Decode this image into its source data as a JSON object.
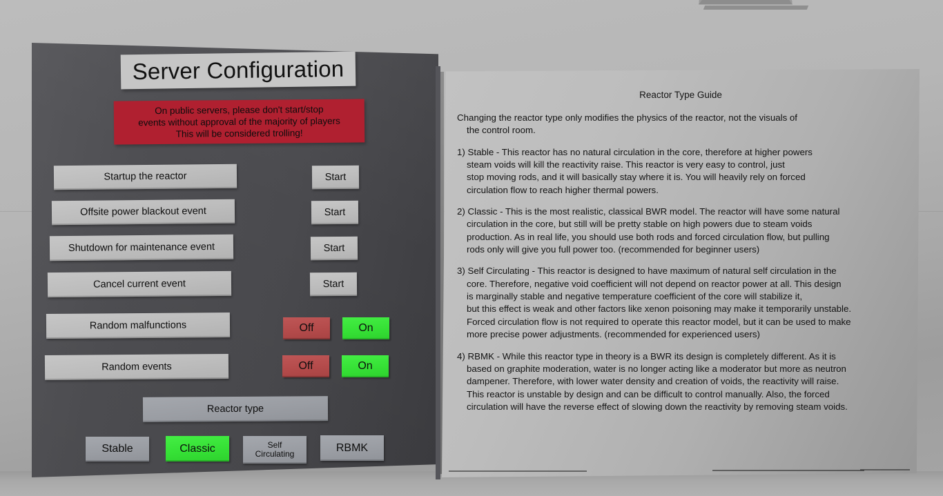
{
  "left_panel": {
    "title": "Server Configuration",
    "warning_lines": [
      "On public servers, please don't start/stop",
      "events without approval of the majority of players",
      "This will be considered trolling!"
    ],
    "actions": [
      {
        "label": "Startup the reactor",
        "button": "Start"
      },
      {
        "label": "Offsite power blackout event",
        "button": "Start"
      },
      {
        "label": "Shutdown for maintenance event",
        "button": "Start"
      },
      {
        "label": "Cancel current event",
        "button": "Start"
      }
    ],
    "toggles": [
      {
        "label": "Random malfunctions",
        "off": "Off",
        "on": "On",
        "selected": "On"
      },
      {
        "label": "Random events",
        "off": "Off",
        "on": "On",
        "selected": "On"
      }
    ],
    "reactor_type_label": "Reactor type",
    "reactor_types": [
      {
        "label": "Stable",
        "line1": "Stable",
        "line2": "",
        "selected": false
      },
      {
        "label": "Classic",
        "line1": "Classic",
        "line2": "",
        "selected": true
      },
      {
        "label": "Self Circulating",
        "line1": "Self",
        "line2": "Circulating",
        "selected": false
      },
      {
        "label": "RBMK",
        "line1": "RBMK",
        "line2": "",
        "selected": false
      }
    ]
  },
  "right_panel": {
    "title": "Reactor Type Guide",
    "paragraphs": [
      {
        "lines": [
          "Changing the reactor type only modifies the physics of the reactor, not the visuals of",
          "the control room."
        ],
        "indent_from": 1
      },
      {
        "lines": [
          "1) Stable - This reactor has no natural circulation in the core, therefore at higher powers",
          "steam voids will kill the reactivity raise.  This reactor is very easy to control, just",
          "stop moving rods, and it will basically stay where it is. You will heavily rely on forced",
          "circulation flow to reach higher thermal powers."
        ],
        "indent_from": 1
      },
      {
        "lines": [
          "2) Classic - This is the most realistic, classical BWR model. The reactor will have some natural",
          "circulation in the core, but still will be pretty stable on high powers due to steam voids",
          "production. As in real life, you should use both rods and forced circulation flow, but pulling",
          "rods only will give you full power too. (recommended for beginner users)"
        ],
        "indent_from": 1
      },
      {
        "lines": [
          "3) Self Circulating - This reactor is designed to have maximum of natural self circulation in the",
          "core. Therefore, negative void coefficient will not depend on reactor power at all. This design",
          "is marginally stable and negative temperature coefficient of the core will stabilize it,",
          "but this effect is weak and other factors like xenon poisoning may make it temporarily unstable.",
          "Forced circulation flow is not required to operate this reactor model, but it can be used to make",
          "more precise power adjustments. (recommended for experienced users)"
        ],
        "indent_from": 1
      },
      {
        "lines": [
          "4) RBMK - While this reactor type in theory is a BWR its design is completely different. As it is",
          "based on graphite moderation, water is no longer acting like a moderator but more as neutron",
          "dampener. Therefore, with lower water density and creation of voids, the reactivity will raise.",
          "This reactor is unstable by design and can be difficult to control manually. Also, the forced",
          "circulation will have the reverse effect of slowing down the reactivity by removing steam voids."
        ],
        "indent_from": 1
      }
    ]
  },
  "colors": {
    "background_wall": "#b6b6b6",
    "left_panel": "#4a4a4e",
    "right_panel": "#bdbdbd",
    "title_plate": "#c6c6c6",
    "warning_red": "#b02030",
    "button_gray": "#bcbcbc",
    "toggle_off_red": "#b44b4b",
    "toggle_on_green": "#36e136",
    "selected_green": "#36e136",
    "reactor_button_gray": "#9a9da3",
    "text_dark": "#111111",
    "ceiling_sign_red": "#8e1b1b"
  }
}
